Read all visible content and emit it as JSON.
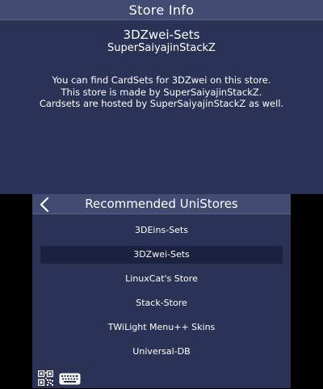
{
  "top_screen": {
    "header_title": "Store Info",
    "store_name": "3DZwei-Sets",
    "store_author": "SuperSaiyajinStackZ",
    "description_lines": [
      "You can find CardSets for 3DZwei on this store.",
      "This store is made by SuperSaiyajinStackZ.",
      "Cardsets are hosted by SuperSaiyajinStackZ as well."
    ]
  },
  "bottom_screen": {
    "header_title": "Recommended UniStores",
    "back_icon": "chevron-left-icon",
    "stores": [
      {
        "label": "3DEins-Sets",
        "selected": false
      },
      {
        "label": "3DZwei-Sets",
        "selected": true
      },
      {
        "label": "LinuxCat's Store",
        "selected": false
      },
      {
        "label": "Stack-Store",
        "selected": false
      },
      {
        "label": "TWiLight Menu++ Skins",
        "selected": false
      },
      {
        "label": "Universal-DB",
        "selected": false
      }
    ],
    "toolbar": {
      "qr_icon": "qr-code-icon",
      "keyboard_icon": "keyboard-icon"
    }
  },
  "colors": {
    "background": "#2a3256",
    "header": "#424b71",
    "selected_row": "#1b2140",
    "text": "#ffffff",
    "outside": "#000000"
  }
}
